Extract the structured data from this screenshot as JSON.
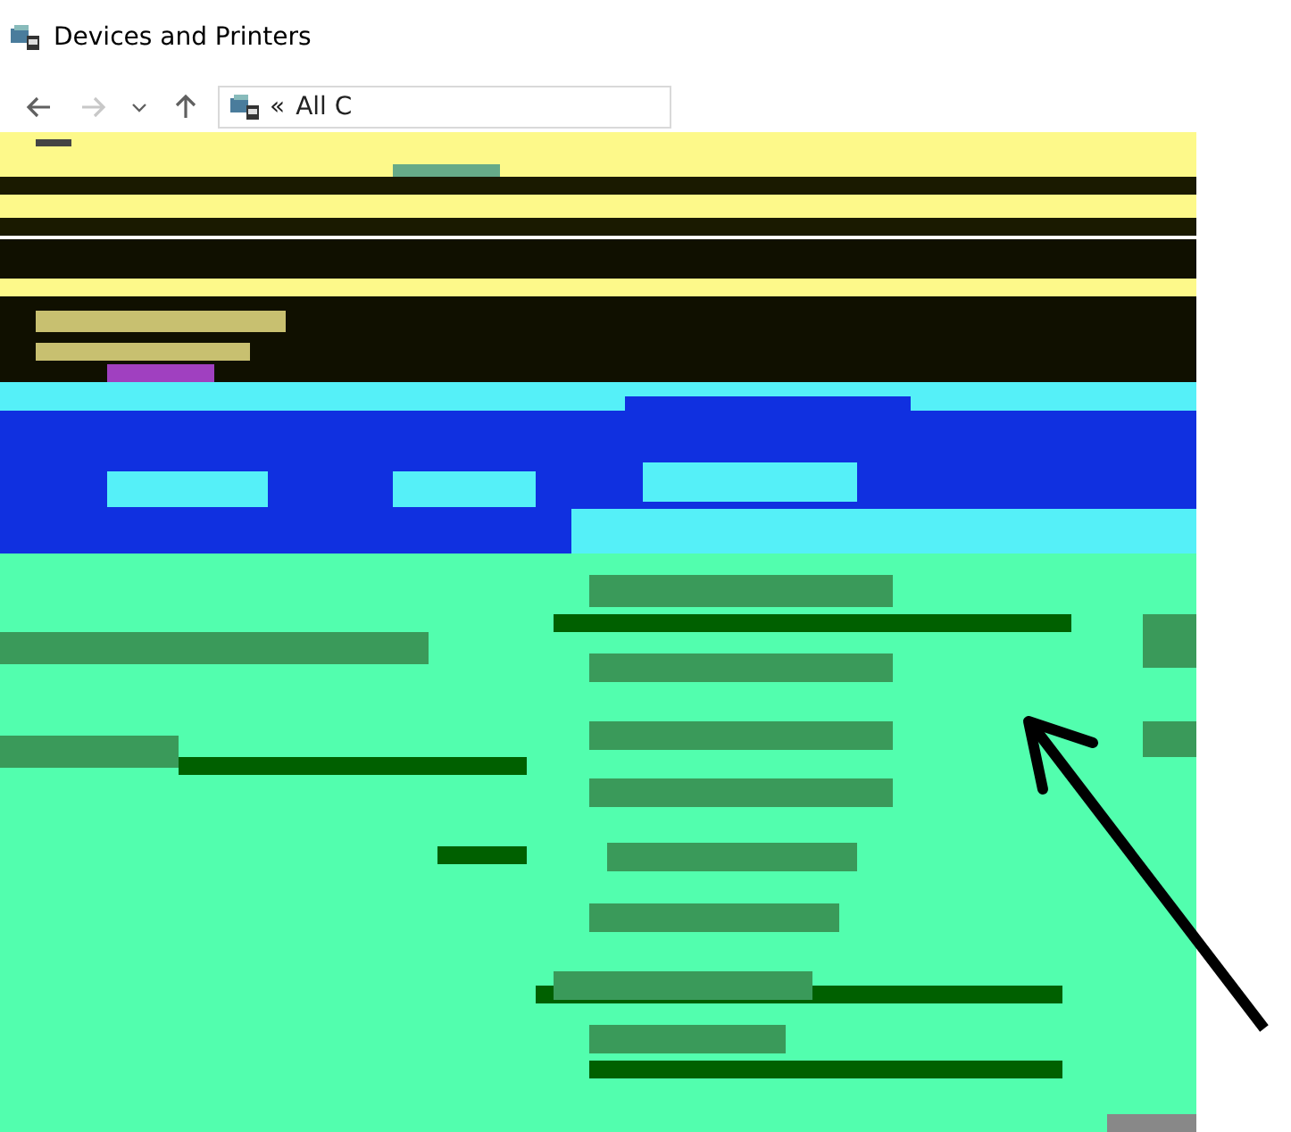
{
  "window": {
    "title": "Devices and Printers"
  },
  "navigation": {
    "buttons": [
      {
        "kind": "back",
        "disabled": false
      },
      {
        "kind": "forward",
        "disabled": true
      },
      {
        "kind": "recent",
        "disabled": false
      },
      {
        "kind": "up",
        "disabled": false
      }
    ],
    "address_bar": {
      "overflow": "«",
      "path": "All C"
    }
  }
}
